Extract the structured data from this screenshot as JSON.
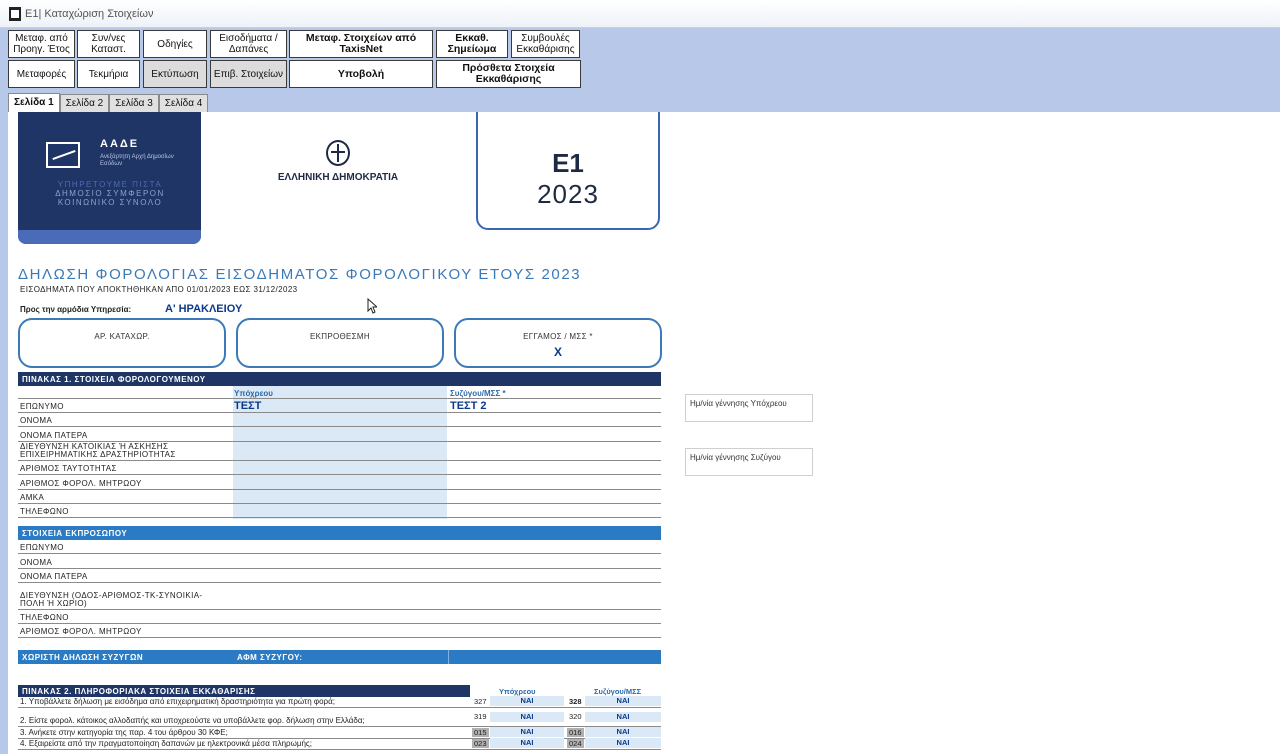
{
  "window": {
    "title": "E1| Καταχώριση Στοιχείων"
  },
  "toolbar": {
    "row1": [
      "Μεταφ. από Προηγ. Έτος",
      "Συν/νες Καταστ.",
      "Οδηγίες",
      "Εισοδήματα / Δαπάνες",
      "Μεταφ. Στοιχείων από TaxisNet",
      "Εκκαθ. Σημείωμα",
      "Συμβουλές Εκκαθάρισης"
    ],
    "row2": [
      "Μεταφορές",
      "Τεκμήρια",
      "Εκτύπωση",
      "Επιβ. Στοιχείων",
      "Υποβολή",
      "Πρόσθετα Στοιχεία Εκκαθάρισης"
    ]
  },
  "tabs": [
    "Σελίδα 1",
    "Σελίδα 2",
    "Σελίδα 3",
    "Σελίδα 4"
  ],
  "header": {
    "aade_name": "ΑΑΔΕ",
    "aade_sub": "Ανεξάρτητη Αρχή Δημοσίων Εσόδων",
    "motto_1": "ΥΠΗΡΕΤΟΥΜΕ ΠΙΣΤΑ",
    "motto_2": "ΔΗΜΟΣΙΟ ΣΥΜΦΕΡΟΝ",
    "motto_3": "ΚΟΙΝΩΝΙΚΟ ΣΥΝΟΛΟ",
    "republic": "ΕΛΛΗΝΙΚΗ ΔΗΜΟΚΡΑΤΙΑ",
    "form": "Ε1",
    "year": "2023"
  },
  "doc": {
    "title": "ΔΗΛΩΣΗ ΦΟΡΟΛΟΓΙΑΣ ΕΙΣΟΔΗΜΑΤΟΣ ΦΟΡΟΛΟΓΙΚΟΥ ΕΤΟΥΣ 2023",
    "subtitle": "ΕΙΣΟΔΗΜΑΤΑ ΠΟΥ ΑΠΟΚΤΗΘΗΚΑΝ ΑΠΟ 01/01/2023 ΕΩΣ 31/12/2023",
    "service_label": "Προς την αρμόδια Υπηρεσία:",
    "service_value": "Α' ΗΡΑΚΛΕΙΟΥ",
    "pills": [
      {
        "label": "ΑΡ. ΚΑΤΑΧΩΡ.",
        "value": ""
      },
      {
        "label": "ΕΚΠΡΟΘΕΣΜΗ",
        "value": ""
      },
      {
        "label": "ΕΓΓΑΜΟΣ / ΜΣΣ *",
        "value": "Χ"
      }
    ]
  },
  "table1": {
    "title": "ΠΙΝΑΚΑΣ 1. ΣΤΟΙΧΕΙΑ ΦΟΡΟΛΟΓΟΥΜΕΝΟΥ",
    "col_obliged": "Υπόχρεου",
    "col_spouse": "Συζύγου/ΜΣΣ *",
    "rows": [
      "ΕΠΩΝΥΜΟ",
      "ΟΝΟΜΑ",
      "ΟΝΟΜΑ ΠΑΤΕΡΑ",
      "ΔΙΕΥΘΥΝΣΗ ΚΑΤΟΙΚΙΑΣ Ή ΑΣΚΗΣΗΣ ΕΠΙΧΕΙΡΗΜΑΤΙΚΗΣ ΔΡΑΣΤΗΡΙΟΤΗΤΑΣ",
      "ΑΡΙΘΜΟΣ ΤΑΥΤΟΤΗΤΑΣ",
      "ΑΡΙΘΜΟΣ ΦΟΡΟΛ. ΜΗΤΡΩΟΥ",
      "ΑΜΚΑ",
      "ΤΗΛΕΦΩΝΟ"
    ],
    "surname_obliged": "ΤΕΣΤ",
    "surname_spouse": "ΤΕΣΤ 2"
  },
  "side": {
    "dob_obliged": "Ημ/νία γέννησης Υπόχρεου",
    "dob_spouse": "Ημ/νία γέννησης Συζύγου"
  },
  "representative": {
    "title": "ΣΤΟΙΧΕΙΑ ΕΚΠΡΟΣΩΠΟΥ",
    "rows": [
      "ΕΠΩΝΥΜΟ",
      "ΟΝΟΜΑ",
      "ΟΝΟΜΑ ΠΑΤΕΡΑ",
      "ΔΙΕΥΘΥΝΣΗ (ΟΔΟΣ-ΑΡΙΘΜΟΣ-ΤΚ-ΣΥΝΟΙΚΙΑ-ΠΟΛΗ Ή ΧΩΡΙΟ)",
      "ΤΗΛΕΦΩΝΟ",
      "ΑΡΙΘΜΟΣ ΦΟΡΟΛ. ΜΗΤΡΩΟΥ"
    ]
  },
  "separate": {
    "label": "ΧΩΡΙΣΤΗ ΔΗΛΩΣΗ ΣΥΖΥΓΩΝ",
    "afm_label": "ΑΦΜ ΣΥΖΥΓΟΥ:"
  },
  "table2": {
    "title": "ΠΙΝΑΚΑΣ 2. ΠΛΗΡΟΦΟΡΙΑΚΑ ΣΤΟΙΧΕΙΑ ΕΚΚΑΘΑΡΙΣΗΣ",
    "col_obliged": "Υπόχρεου",
    "col_spouse": "Συζύγου/ΜΣΣ",
    "rows": [
      {
        "text": "1.  Υποβάλλετε δήλωση με εισόδημα από επιχειρηματική δραστηριότητα για πρώτη φορά;",
        "code1": "327",
        "val1": "ΝΑΙ",
        "code2": "328",
        "val2": "ΝΑΙ"
      },
      {
        "text": "2.  Είστε φορολ. κάτοικος αλλοδαπής και υποχρεούστε να υποβάλλετε φορ. δήλωση στην Ελλάδα;",
        "code1": "319",
        "val1": "ΝΑΙ",
        "code2": "320",
        "val2": "ΝΑΙ"
      },
      {
        "text": "3.  Ανήκετε στην κατηγορία της παρ. 4 του άρθρου 30 ΚΦΕ;",
        "code1": "015",
        "val1": "ΝΑΙ",
        "code2": "016",
        "val2": "ΝΑΙ"
      },
      {
        "text": "4.  Εξαιρείστε από την πραγματοποίηση δαπανών με ηλεκτρονικά μέσα πληρωμής;",
        "code1": "023",
        "val1": "ΝΑΙ",
        "code2": "024",
        "val2": "ΝΑΙ"
      }
    ]
  }
}
